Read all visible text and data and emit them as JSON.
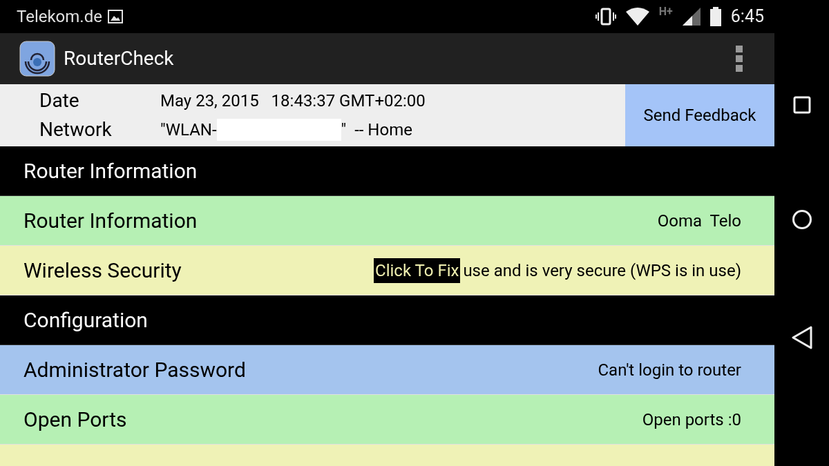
{
  "status_bar": {
    "carrier": "Telekom.de",
    "time": "6:45",
    "network_type": "H+"
  },
  "app_bar": {
    "title": "RouterCheck"
  },
  "info": {
    "fields": [
      {
        "label": "Date",
        "value": "May 23, 2015   18:43:37 GMT+02:00"
      },
      {
        "label": "Network",
        "value_prefix": "\"WLAN-",
        "value_suffix": "\"  -- Home"
      }
    ],
    "feedback_button": "Send Feedback"
  },
  "rows": [
    {
      "kind": "header",
      "label": "Router Information"
    },
    {
      "kind": "item",
      "label": "Router Information",
      "value": "Ooma  Telo",
      "color": "#b6f0b4"
    },
    {
      "kind": "item",
      "label": "Wireless Security",
      "fix": "Click To Fix",
      "value": "use and is very secure (WPS is in use)",
      "color": "#eff2b6"
    },
    {
      "kind": "header",
      "label": "Configuration"
    },
    {
      "kind": "item",
      "label": "Administrator Password",
      "value": "Can't login to router",
      "color": "#a4c4ee"
    },
    {
      "kind": "item",
      "label": "Open Ports",
      "value": "Open ports :0",
      "color": "#b6f0b4"
    },
    {
      "kind": "partial",
      "color": "#eff2b6"
    }
  ]
}
